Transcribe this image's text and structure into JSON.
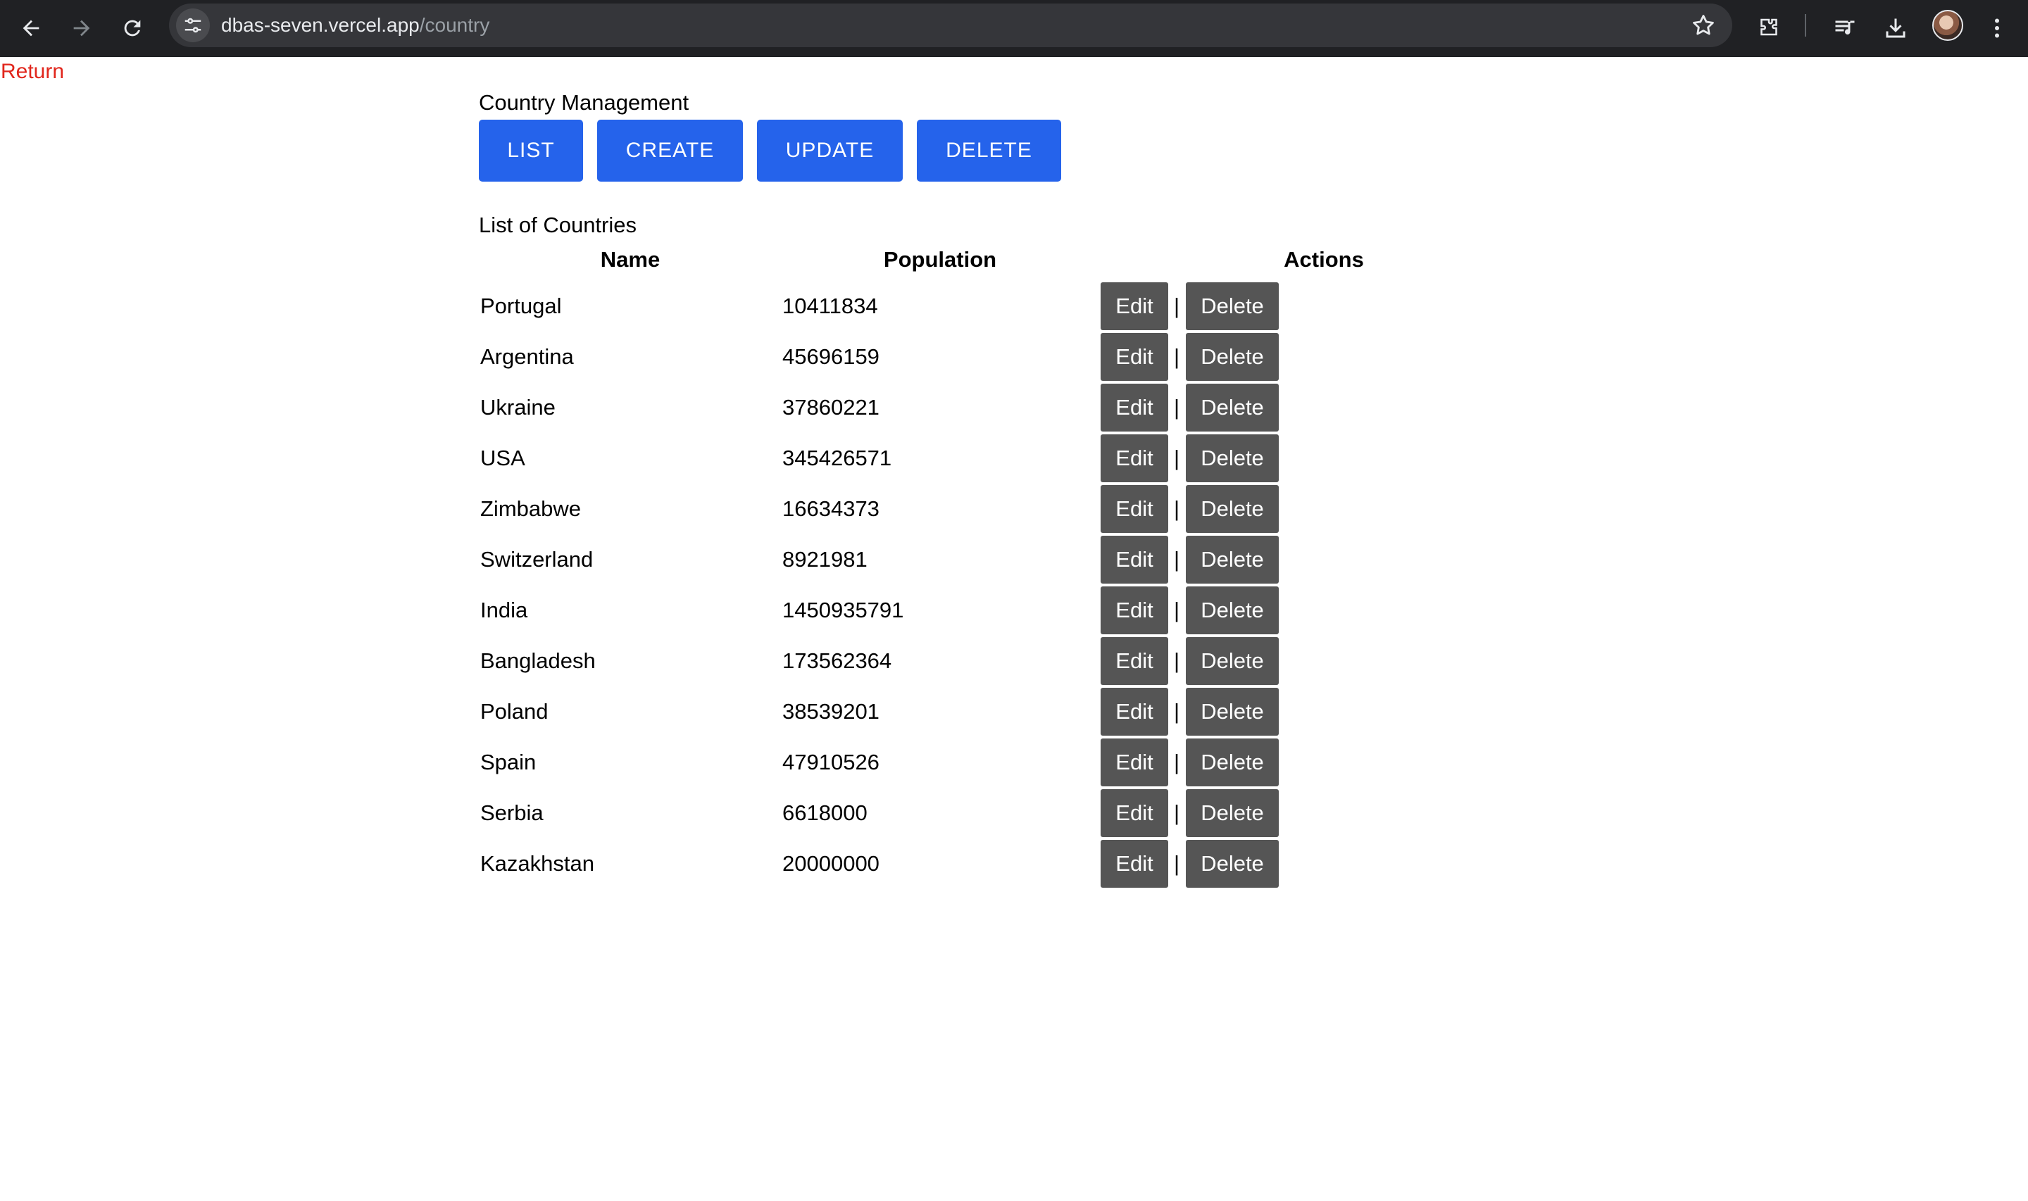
{
  "browser": {
    "url_host": "dbas-seven.vercel.app",
    "url_path": "/country"
  },
  "page": {
    "return_label": "Return",
    "heading": "Country Management",
    "tabs": [
      {
        "label": "LIST"
      },
      {
        "label": "CREATE"
      },
      {
        "label": "UPDATE"
      },
      {
        "label": "DELETE"
      }
    ],
    "list_title": "List of Countries",
    "columns": [
      "Name",
      "Population",
      "Actions"
    ],
    "edit_label": "Edit",
    "delete_label": "Delete",
    "separator": "|",
    "rows": [
      {
        "name": "Portugal",
        "population": "10411834"
      },
      {
        "name": "Argentina",
        "population": "45696159"
      },
      {
        "name": "Ukraine",
        "population": "37860221"
      },
      {
        "name": "USA",
        "population": "345426571"
      },
      {
        "name": "Zimbabwe",
        "population": "16634373"
      },
      {
        "name": "Switzerland",
        "population": "8921981"
      },
      {
        "name": "India",
        "population": "1450935791"
      },
      {
        "name": "Bangladesh",
        "population": "173562364"
      },
      {
        "name": "Poland",
        "population": "38539201"
      },
      {
        "name": "Spain",
        "population": "47910526"
      },
      {
        "name": "Serbia",
        "population": "6618000"
      },
      {
        "name": "Kazakhstan",
        "population": "20000000"
      }
    ]
  },
  "colors": {
    "primary_button": "#2563eb",
    "action_button": "#555555",
    "return_link": "#e1261c"
  }
}
